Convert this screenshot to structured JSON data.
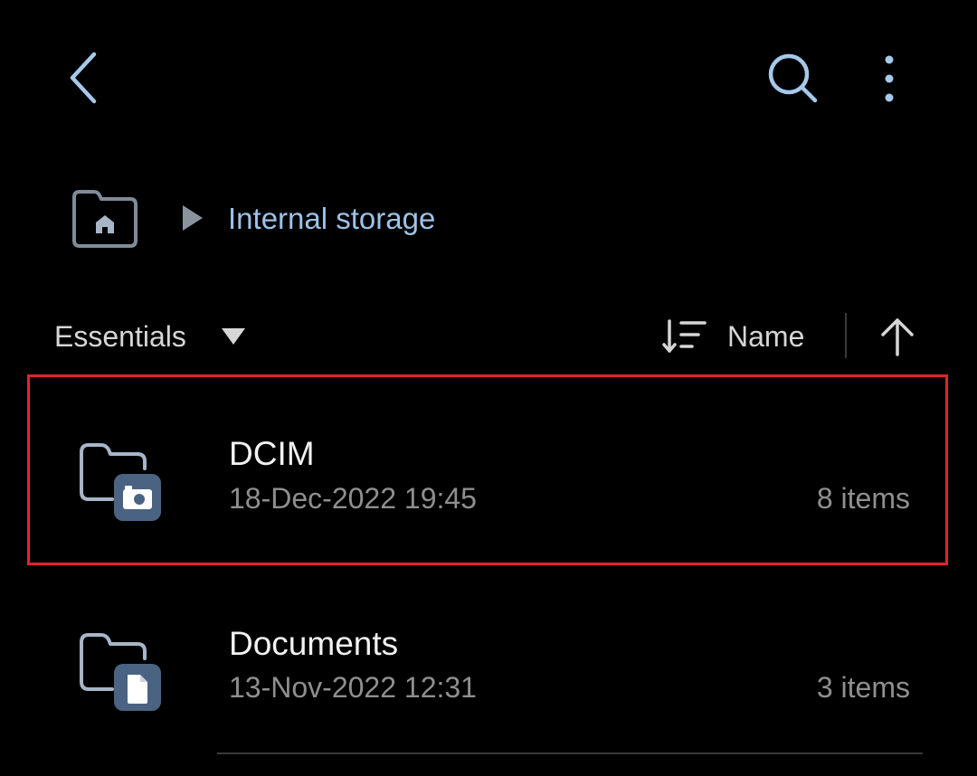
{
  "topbar": {
    "back_icon": "chevron-left-icon",
    "search_icon": "search-icon",
    "more_icon": "more-vertical-icon",
    "icon_color": "#a6c8ea"
  },
  "breadcrumb": {
    "home_icon": "home-folder-icon",
    "separator_icon": "play-right-icon",
    "current": "Internal storage",
    "current_color": "#9cc2e8"
  },
  "filter": {
    "label": "Essentials",
    "dropdown_icon": "triangle-down-icon"
  },
  "sort": {
    "icon": "sort-icon",
    "label": "Name",
    "direction_icon": "arrow-up-icon"
  },
  "files": [
    {
      "name": "DCIM",
      "date": "18-Dec-2022 19:45",
      "count": "8 items",
      "icon": "camera-folder-icon",
      "highlighted": true
    },
    {
      "name": "Documents",
      "date": "13-Nov-2022 12:31",
      "count": "3 items",
      "icon": "document-folder-icon",
      "highlighted": false
    }
  ],
  "colors": {
    "background": "#000000",
    "highlight_border": "#e0242c",
    "badge": "#4a6383",
    "folder_outline": "#a7b6c7"
  }
}
